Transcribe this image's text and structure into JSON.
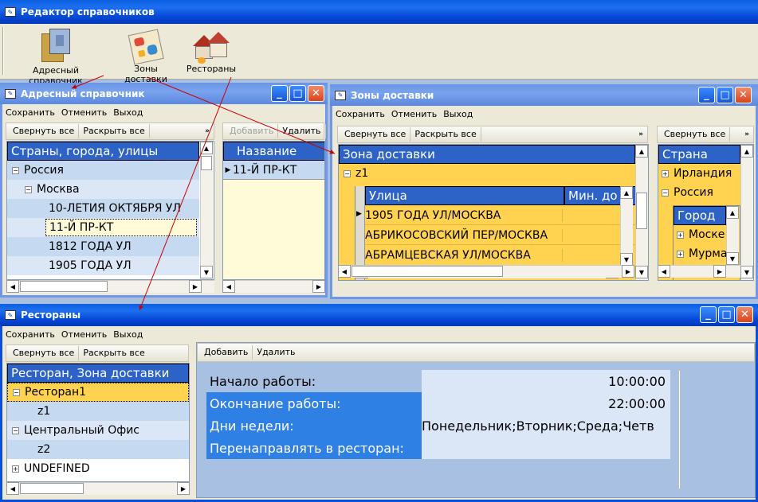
{
  "app": {
    "title": "Редактор справочников"
  },
  "launcher": [
    {
      "label": "Адресный справочник",
      "icon": "address-book-icon"
    },
    {
      "label": "Зоны доставки",
      "icon": "map-icon"
    },
    {
      "label": "Рестораны",
      "icon": "houses-icon"
    }
  ],
  "address_win": {
    "title": "Адресный справочник",
    "menu": [
      "Сохранить",
      "Отменить",
      "Выход"
    ],
    "toolbar": {
      "collapse": "Свернуть все",
      "expand": "Раскрыть все",
      "more": "»"
    },
    "tree_header": "Страны, города, улицы",
    "tree": [
      "Россия",
      "Москва",
      "10-ЛЕТИЯ ОКТЯБРЯ УЛ",
      "11-Й ПР-КТ",
      "1812 ГОДА УЛ",
      "1905 ГОДА УЛ"
    ],
    "right_toolbar": {
      "add": "Добавить",
      "delete": "Удалить"
    },
    "right_header": "Название",
    "right_row": "11-Й ПР-КТ"
  },
  "zones_win": {
    "title": "Зоны доставки",
    "menu": [
      "Сохранить",
      "Отменить",
      "Выход"
    ],
    "toolbar": {
      "collapse": "Свернуть все",
      "expand": "Раскрыть все"
    },
    "zone_header": "Зона доставки",
    "zone": "z1",
    "grid_headers": [
      "Улица",
      "Мин. до"
    ],
    "grid_rows": [
      "1905 ГОДА УЛ/МОСКВА",
      "АБРИКОСОВСКИЙ ПЕР/МОСКВА",
      "АБРАМЦЕВСКАЯ УЛ/МОСКВА"
    ],
    "country_toolbar": "Свернуть все",
    "country_header": "Страна",
    "countries": [
      "Ирландия",
      "Россия"
    ],
    "city_header": "Город",
    "cities": [
      "Моске",
      "Мурма"
    ]
  },
  "rest_win": {
    "title": "Рестораны",
    "menu": [
      "Сохранить",
      "Отменить",
      "Выход"
    ],
    "toolbar": {
      "collapse": "Свернуть все",
      "expand": "Раскрыть все"
    },
    "tree_header": "Ресторан, Зона доставки",
    "tree": [
      "Ресторан1",
      "z1",
      "Центральный Офис",
      "z2",
      "UNDEFINED"
    ],
    "right_toolbar": {
      "add": "Добавить",
      "delete": "Удалить"
    },
    "props": [
      {
        "k": "Начало работы:",
        "v": "10:00:00"
      },
      {
        "k": "Окончание работы:",
        "v": "22:00:00"
      },
      {
        "k": "Дни недели:",
        "v": "Понедельник;Вторник;Среда;Четв"
      },
      {
        "k": "Перенаправлять в ресторан:",
        "v": ""
      }
    ]
  },
  "colors": {
    "accent": "#0b4ed8",
    "header": "#2d63c6",
    "zone_bg": "#ffd24f",
    "arrow": "#cc0000"
  }
}
